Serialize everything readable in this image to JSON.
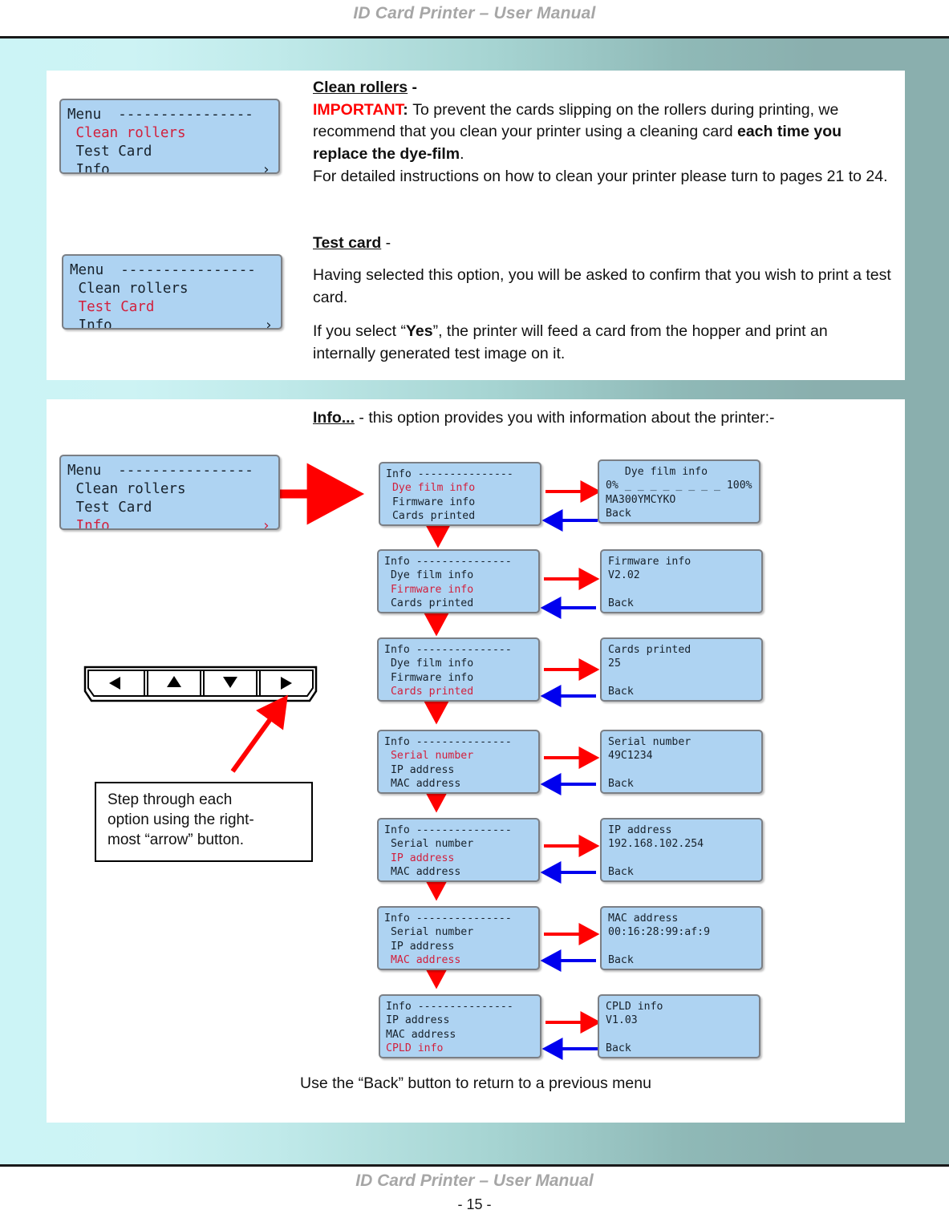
{
  "header": {
    "title": "ID Card Printer – User Manual"
  },
  "footer": {
    "title": "ID Card Printer – User Manual",
    "page": "- 15 -"
  },
  "sections": {
    "clean_rollers": {
      "heading": "Clean rollers",
      "heading_suffix": " -",
      "important_label": "IMPORTANT",
      "important_colon": ": ",
      "body_1": "To prevent the cards slipping on the rollers during printing, we recommend that you clean your printer using a cleaning card ",
      "body_bold": "each time you replace the dye-film",
      "body_2": ".",
      "body_3": "For detailed instructions on how to clean your printer please turn to pages 21 to 24."
    },
    "test_card": {
      "heading": "Test card",
      "heading_suffix": " -",
      "para_1": "Having selected this option, you will be asked to confirm that you wish to print a test card.",
      "para_2_pre": "If you select “",
      "para_2_bold": "Yes",
      "para_2_post": "”, the printer will feed a card from the hopper and print an internally generated test image on it."
    },
    "info": {
      "heading": "Info...",
      "heading_suffix": " - this option provides you with information about the printer:-",
      "back_note": "Use the “Back” button to return to a previous menu"
    }
  },
  "callout": {
    "line_1": "Step through each",
    "line_2": "option using the right-",
    "line_3": "most “arrow” button."
  },
  "keypad": {
    "buttons": [
      {
        "name": "left-arrow-button",
        "glyph": "◀"
      },
      {
        "name": "up-arrow-button",
        "glyph": "▲"
      },
      {
        "name": "down-arrow-button",
        "glyph": "▼"
      },
      {
        "name": "right-arrow-button",
        "glyph": "▶"
      }
    ]
  },
  "lcd_menus": [
    {
      "id": "menu-clean",
      "title": "Menu",
      "dashes": "----------------",
      "chevron": "›",
      "items": [
        {
          "label": " Clean rollers",
          "selected": true
        },
        {
          "label": " Test Card",
          "selected": false
        },
        {
          "label": " Info",
          "selected": false
        }
      ]
    },
    {
      "id": "menu-test",
      "title": "Menu",
      "dashes": "----------------",
      "chevron": "›",
      "items": [
        {
          "label": " Clean rollers",
          "selected": false
        },
        {
          "label": " Test Card",
          "selected": true
        },
        {
          "label": " Info",
          "selected": false
        }
      ]
    },
    {
      "id": "menu-info",
      "title": "Menu",
      "dashes": "----------------",
      "chevron": "›",
      "items": [
        {
          "label": " Clean rollers",
          "selected": false
        },
        {
          "label": " Test Card",
          "selected": false
        },
        {
          "label": " Info",
          "selected": true
        }
      ]
    }
  ],
  "info_flow": [
    {
      "step": {
        "title": "Info",
        "dashes": "---------------",
        "items": [
          {
            "label": " Dye film info",
            "selected": true
          },
          {
            "label": " Firmware info",
            "selected": false
          },
          {
            "label": " Cards printed",
            "selected": false
          }
        ]
      },
      "result": {
        "lines": [
          "   Dye film info",
          "0% _ _ _ _ _ _ _ _ 100%",
          "MA300YMCYKO",
          "Back"
        ]
      }
    },
    {
      "step": {
        "title": "Info",
        "dashes": "---------------",
        "items": [
          {
            "label": " Dye film info",
            "selected": false
          },
          {
            "label": " Firmware info",
            "selected": true
          },
          {
            "label": " Cards printed",
            "selected": false
          }
        ]
      },
      "result": {
        "lines": [
          "Firmware info",
          "V2.02",
          "",
          "Back"
        ]
      }
    },
    {
      "step": {
        "title": "Info",
        "dashes": "---------------",
        "items": [
          {
            "label": " Dye film info",
            "selected": false
          },
          {
            "label": " Firmware info",
            "selected": false
          },
          {
            "label": " Cards printed",
            "selected": true
          }
        ]
      },
      "result": {
        "lines": [
          "Cards printed",
          "25",
          "",
          "Back"
        ]
      }
    },
    {
      "step": {
        "title": "Info",
        "dashes": "---------------",
        "items": [
          {
            "label": " Serial number",
            "selected": true
          },
          {
            "label": " IP address",
            "selected": false
          },
          {
            "label": " MAC address",
            "selected": false
          }
        ]
      },
      "result": {
        "lines": [
          "Serial number",
          "49C1234",
          "",
          "Back"
        ]
      }
    },
    {
      "step": {
        "title": "Info",
        "dashes": "---------------",
        "items": [
          {
            "label": " Serial number",
            "selected": false
          },
          {
            "label": " IP address",
            "selected": true
          },
          {
            "label": " MAC address",
            "selected": false
          }
        ]
      },
      "result": {
        "lines": [
          "IP address",
          "192.168.102.254",
          "",
          "Back"
        ]
      }
    },
    {
      "step": {
        "title": "Info",
        "dashes": "---------------",
        "items": [
          {
            "label": " Serial number",
            "selected": false
          },
          {
            "label": " IP address",
            "selected": false
          },
          {
            "label": " MAC address",
            "selected": true
          }
        ]
      },
      "result": {
        "lines": [
          "MAC address",
          "00:16:28:99:af:9",
          "",
          "Back"
        ]
      }
    },
    {
      "step": {
        "title": "Info",
        "dashes": "---------------",
        "items": [
          {
            "label": "IP address",
            "selected": false
          },
          {
            "label": "MAC address",
            "selected": false
          },
          {
            "label": "CPLD info",
            "selected": true
          }
        ]
      },
      "result": {
        "lines": [
          "CPLD info",
          "V1.03",
          "",
          "Back"
        ]
      }
    }
  ],
  "colors": {
    "lcd_background": "#aed3f2",
    "lcd_selected_text": "#d21f3c",
    "forward_arrow": "#ff0000",
    "back_arrow": "#0000ee",
    "important": "#ff0000",
    "header_text": "#a6a6a6"
  }
}
